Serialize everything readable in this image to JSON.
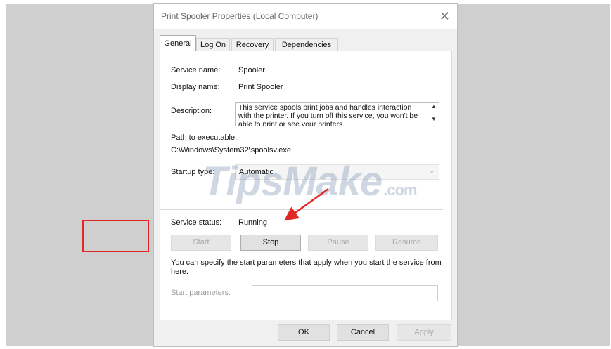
{
  "window": {
    "title": "Print Spooler Properties (Local Computer)",
    "close_glyph": "✕"
  },
  "tabs": [
    {
      "label": "General",
      "active": true
    },
    {
      "label": "Log On",
      "active": false
    },
    {
      "label": "Recovery",
      "active": false
    },
    {
      "label": "Dependencies",
      "active": false
    }
  ],
  "general": {
    "service_name_label": "Service name:",
    "service_name": "Spooler",
    "display_name_label": "Display name:",
    "display_name": "Print Spooler",
    "description_label": "Description:",
    "description": "This service spools print jobs and handles interaction with the printer.  If you turn off this service, you won't be able to print or see your printers.",
    "path_label": "Path to executable:",
    "path": "C:\\Windows\\System32\\spoolsv.exe",
    "startup_type_label": "Startup type:",
    "startup_type": "Automatic",
    "service_status_label": "Service status:",
    "service_status": "Running",
    "buttons": {
      "start": {
        "label": "Start",
        "enabled": false
      },
      "stop": {
        "label": "Stop",
        "enabled": true
      },
      "pause": {
        "label": "Pause",
        "enabled": false
      },
      "resume": {
        "label": "Resume",
        "enabled": false
      }
    },
    "hint": "You can specify the start parameters that apply when you start the service from here.",
    "start_params_label": "Start parameters:",
    "start_params_value": ""
  },
  "footer": {
    "ok": "OK",
    "cancel": "Cancel",
    "apply": "Apply"
  },
  "watermark": {
    "text": "TipsMake",
    "suffix": ".com"
  },
  "annotation": {
    "color": "#e02828"
  },
  "colors": {
    "backdrop": "#cfcfcf",
    "dialog": "#f0f0f0",
    "button": "#e1e1e1"
  }
}
